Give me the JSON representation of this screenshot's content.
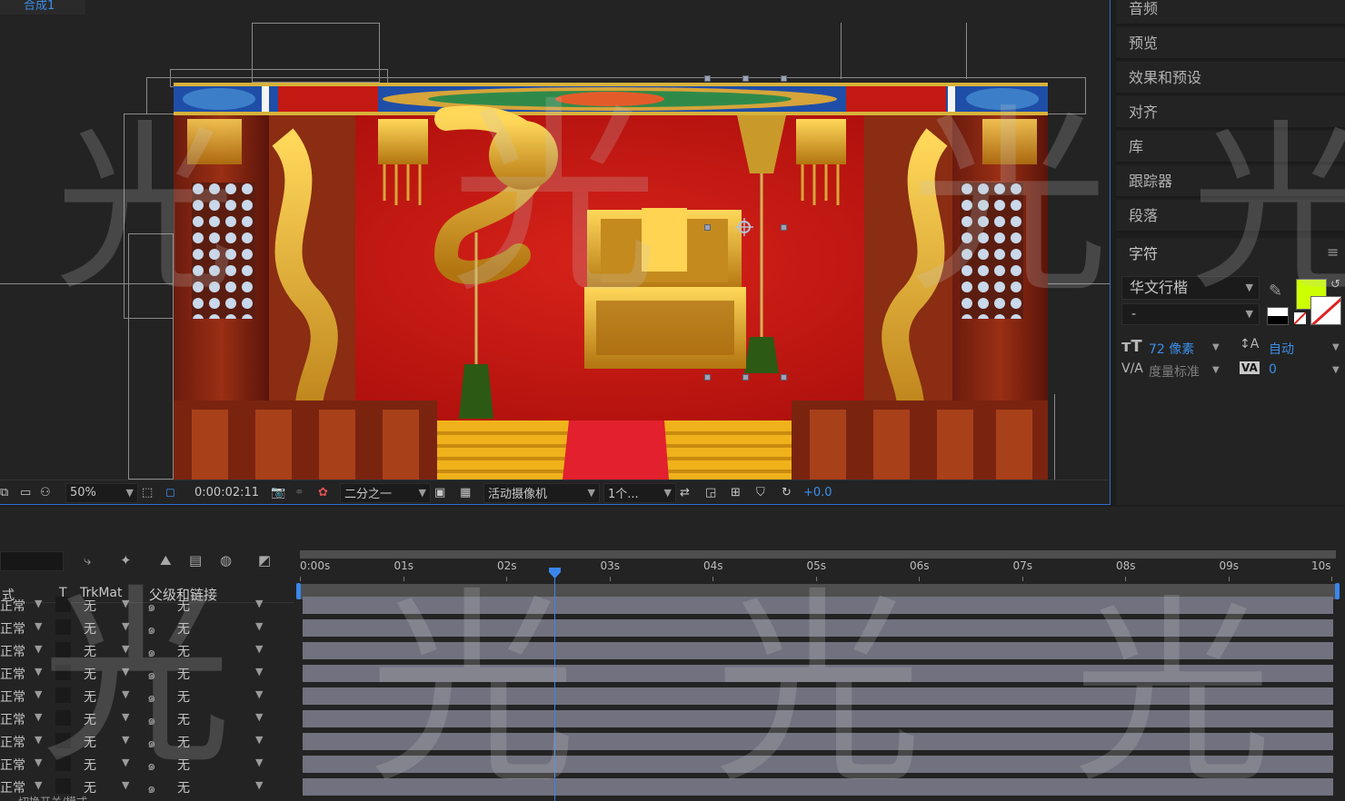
{
  "viewer": {
    "comp_tab": "合成1",
    "toolbar": {
      "zoom": "50%",
      "timecode": "0:00:02:11",
      "resolution": "二分之一",
      "camera": "活动摄像机",
      "views": "1个...",
      "exposure": "+0.0"
    }
  },
  "right_panel": {
    "items": [
      "音频",
      "预览",
      "效果和预设",
      "对齐",
      "库",
      "跟踪器",
      "段落"
    ],
    "character": {
      "title": "字符",
      "font": "华文行楷",
      "style": "-",
      "fill_color": "#ccff00",
      "size": "72 像素",
      "leading": "自动",
      "kerning": "度量标准",
      "tracking": "0"
    }
  },
  "timeline": {
    "columns": {
      "mode": "式",
      "t": "T",
      "trkmat": "TrkMat",
      "parent": "父级和链接"
    },
    "ruler": [
      "0:00s",
      "01s",
      "02s",
      "03s",
      "04s",
      "05s",
      "06s",
      "07s",
      "08s",
      "09s",
      "10s"
    ],
    "rows": [
      {
        "mode": "正常",
        "trkmat": "无",
        "parent": "无"
      },
      {
        "mode": "正常",
        "trkmat": "无",
        "parent": "无"
      },
      {
        "mode": "正常",
        "trkmat": "无",
        "parent": "无"
      },
      {
        "mode": "正常",
        "trkmat": "无",
        "parent": "无"
      },
      {
        "mode": "正常",
        "trkmat": "无",
        "parent": "无"
      },
      {
        "mode": "正常",
        "trkmat": "无",
        "parent": "无"
      },
      {
        "mode": "正常",
        "trkmat": "无",
        "parent": "无"
      },
      {
        "mode": "正常",
        "trkmat": "无",
        "parent": "无"
      },
      {
        "mode": "正常",
        "trkmat": "无",
        "parent": "无"
      }
    ],
    "footer": "切换开关/模式"
  },
  "watermark": {
    "glyph": "光"
  },
  "icons": [
    "camera-icon",
    "color-wheel-icon",
    "snapshot-icon",
    "grid-icon",
    "fast-preview-icon",
    "parent-spiral-icon",
    "eyedropper-icon",
    "swap-color-icon"
  ]
}
